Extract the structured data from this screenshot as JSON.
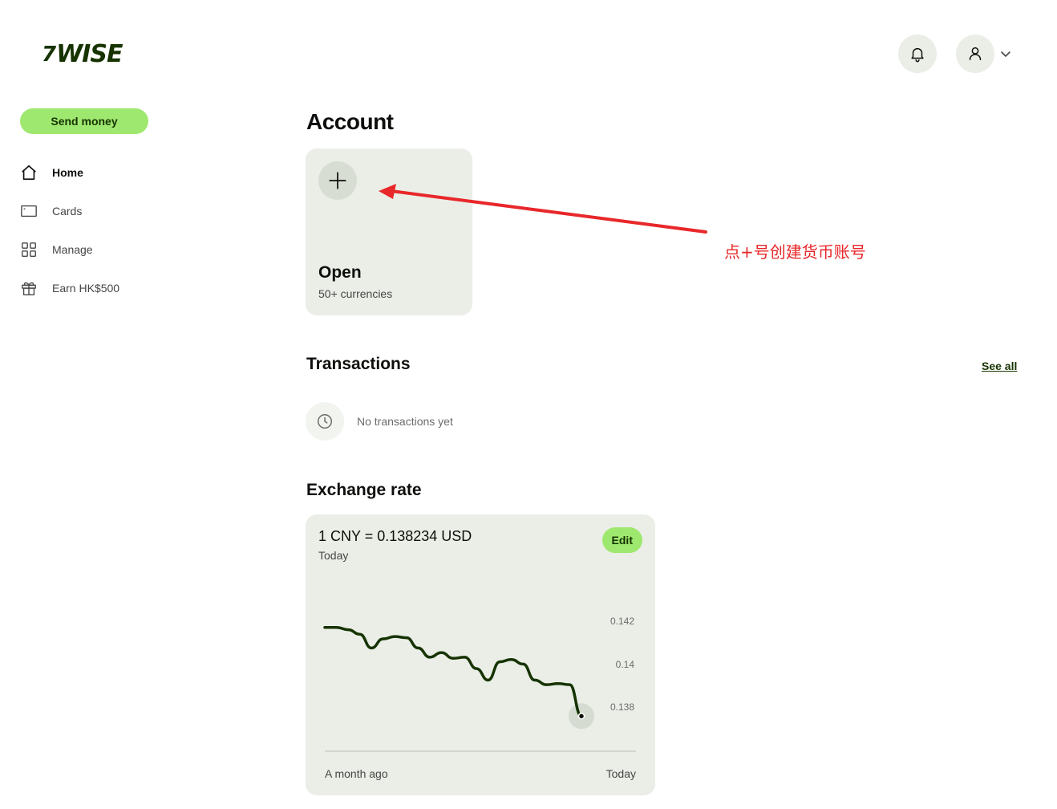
{
  "brand": {
    "logo_mark": "7",
    "logo_text": "WISE"
  },
  "header": {
    "notifications_icon": "bell-icon",
    "profile_icon": "user-icon"
  },
  "sidebar": {
    "send_label": "Send money",
    "items": [
      {
        "label": "Home",
        "icon": "home-icon",
        "active": true
      },
      {
        "label": "Cards",
        "icon": "card-icon",
        "active": false
      },
      {
        "label": "Manage",
        "icon": "grid-icon",
        "active": false
      },
      {
        "label": "Earn HK$500",
        "icon": "gift-icon",
        "active": false
      }
    ]
  },
  "account": {
    "heading": "Account",
    "open_card": {
      "title": "Open",
      "subtitle": "50+ currencies"
    }
  },
  "annotation": {
    "text": "点+号创建货币账号",
    "color": "#e8272a"
  },
  "transactions": {
    "heading": "Transactions",
    "see_all": "See all",
    "empty_text": "No transactions yet"
  },
  "exchange": {
    "heading": "Exchange rate",
    "rate_text": "1 CNY = 0.138234 USD",
    "date_label": "Today",
    "edit_label": "Edit"
  },
  "chart_data": {
    "type": "line",
    "title": "",
    "x_labels": [
      "A month ago",
      "Today"
    ],
    "y_ticks": [
      "0.142",
      "0.14",
      "0.138"
    ],
    "ylim": [
      0.1374,
      0.1437
    ],
    "series": [
      {
        "values": [
          0.1421,
          0.1421,
          0.142,
          0.1418,
          0.1412,
          0.1416,
          0.1417,
          0.14165,
          0.1412,
          0.1408,
          0.141,
          0.14075,
          0.1408,
          0.1403,
          0.1398,
          0.1406,
          0.1407,
          0.1405,
          0.1398,
          0.1396,
          0.13965,
          0.1396,
          0.13823
        ]
      }
    ],
    "line_color": "#163300"
  }
}
